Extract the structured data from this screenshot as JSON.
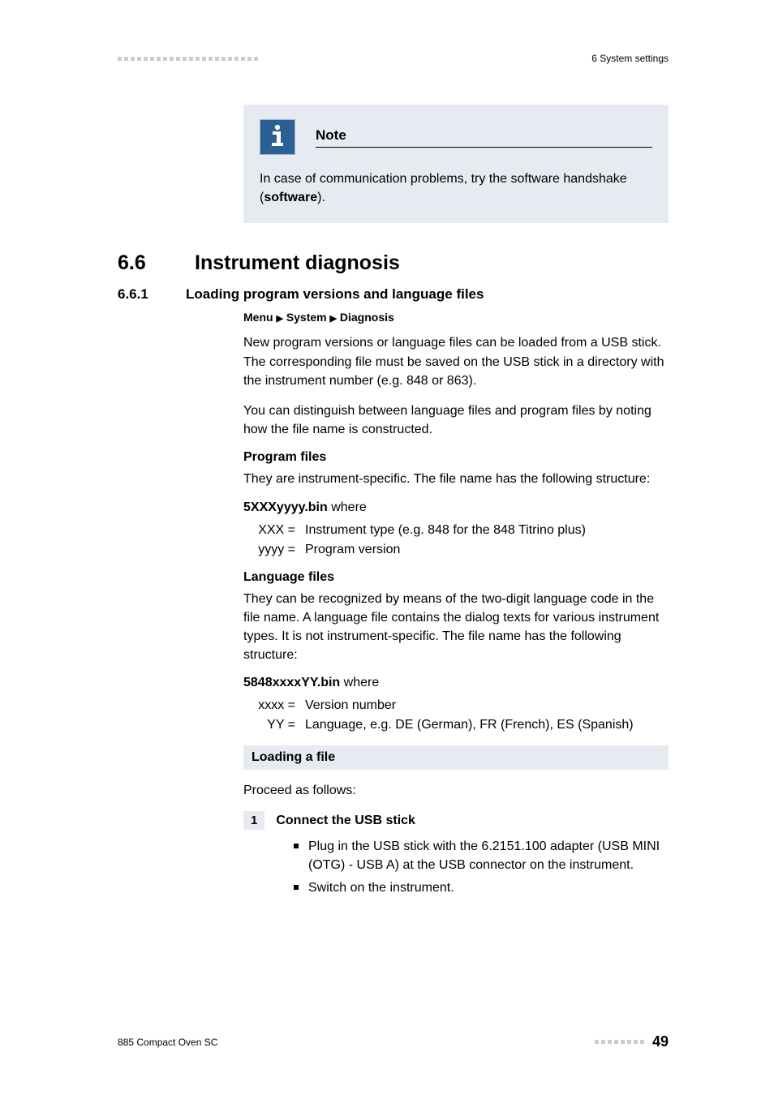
{
  "header": {
    "right": "6 System settings"
  },
  "note": {
    "title": "Note",
    "body_pre": "In case of communication problems, try the software handshake (",
    "body_bold": "software",
    "body_post": ")."
  },
  "section": {
    "num": "6.6",
    "title": "Instrument diagnosis"
  },
  "subsection": {
    "num": "6.6.1",
    "title": "Loading program versions and language files"
  },
  "menupath": {
    "p1": "Menu",
    "p2": "System",
    "p3": "Diagnosis"
  },
  "paras": {
    "p1": "New program versions or language files can be loaded from a USB stick. The corresponding file must be saved on the USB stick in a directory with the instrument number (e.g. 848 or 863).",
    "p2": "You can distinguish between language files and program files by noting how the file name is constructed."
  },
  "progfiles": {
    "heading": "Program files",
    "desc": "They are instrument-specific. The file name has the following structure:",
    "fname": "5XXXyyyy.bin",
    "where": " where",
    "def1k": "XXX =",
    "def1v": "Instrument type (e.g. 848 for the 848 Titrino plus)",
    "def2k": "yyyy =",
    "def2v": "Program version"
  },
  "langfiles": {
    "heading": "Language files",
    "desc": "They can be recognized by means of the two-digit language code in the file name. A language file contains the dialog texts for various instrument types. It is not instrument-specific. The file name has the following structure:",
    "fname": "5848xxxxYY.bin",
    "where": " where",
    "def1k": "xxxx =",
    "def1v": "Version number",
    "def2k": "YY =",
    "def2v": "Language, e.g. DE (German), FR (French), ES (Spanish)"
  },
  "loading": {
    "bar": "Loading a file",
    "proceed": "Proceed as follows:",
    "step1num": "1",
    "step1title": "Connect the USB stick",
    "step1a": "Plug in the USB stick with the 6.2151.100 adapter (USB MINI (OTG) - USB A) at the USB connector on the instrument.",
    "step1b": "Switch on the instrument."
  },
  "footer": {
    "left": "885 Compact Oven SC",
    "page": "49"
  }
}
